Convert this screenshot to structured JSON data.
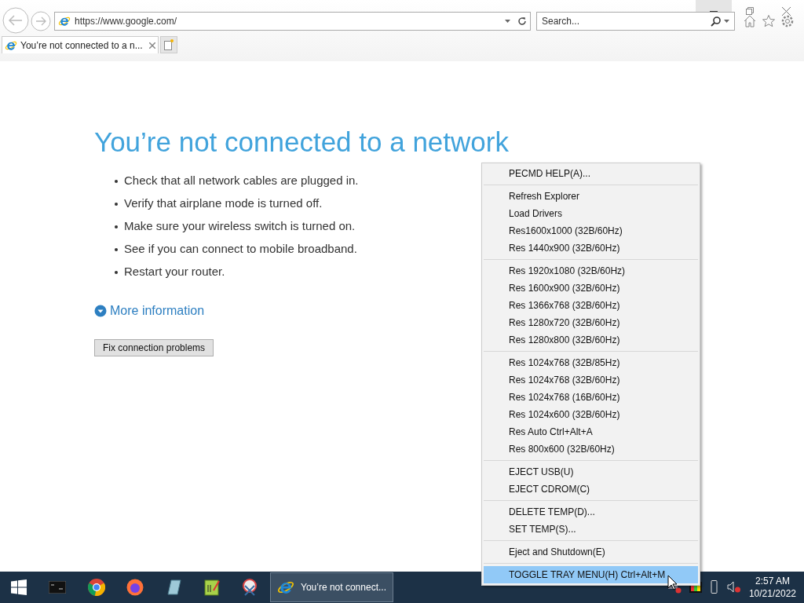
{
  "browser": {
    "address": "https://www.google.com/",
    "search_placeholder": "Search...",
    "tabs": [
      {
        "label": "You’re not connected to a n...",
        "selected": true
      }
    ]
  },
  "page": {
    "heading": "You’re not connected to a network",
    "bullets": [
      "Check that all network cables are plugged in.",
      "Verify that airplane mode is turned off.",
      "Make sure your wireless switch is turned on.",
      "See if you can connect to mobile broadband.",
      "Restart your router."
    ],
    "more_info": "More information",
    "fix_button": "Fix connection problems"
  },
  "context_menu": {
    "groups": [
      {
        "items": [
          {
            "label": "PECMD HELP(A)...",
            "selected": false
          }
        ]
      },
      {
        "items": [
          {
            "label": "Refresh Explorer",
            "selected": false
          },
          {
            "label": "Load Drivers",
            "selected": false
          },
          {
            "label": "Res1600x1000 (32B/60Hz)",
            "selected": false
          },
          {
            "label": "Res 1440x900 (32B/60Hz)",
            "selected": false
          }
        ]
      },
      {
        "items": [
          {
            "label": "Res 1920x1080 (32B/60Hz)",
            "selected": false
          },
          {
            "label": "Res 1600x900 (32B/60Hz)",
            "selected": false
          },
          {
            "label": "Res 1366x768 (32B/60Hz)",
            "selected": false
          },
          {
            "label": "Res 1280x720 (32B/60Hz)",
            "selected": false
          },
          {
            "label": "Res 1280x800 (32B/60Hz)",
            "selected": false
          }
        ]
      },
      {
        "items": [
          {
            "label": "Res 1024x768 (32B/85Hz)",
            "selected": false
          },
          {
            "label": "Res 1024x768 (32B/60Hz)",
            "selected": false
          },
          {
            "label": "Res 1024x768 (16B/60Hz)",
            "selected": false
          },
          {
            "label": "Res 1024x600 (32B/60Hz)",
            "selected": false
          },
          {
            "label": "Res Auto Ctrl+Alt+A",
            "selected": false
          },
          {
            "label": "Res 800x600 (32B/60Hz)",
            "selected": false
          }
        ]
      },
      {
        "items": [
          {
            "label": "EJECT USB(U)",
            "selected": false
          },
          {
            "label": "EJECT CDROM(C)",
            "selected": false
          }
        ]
      },
      {
        "items": [
          {
            "label": "DELETE TEMP(D)...",
            "selected": false
          },
          {
            "label": "SET TEMP(S)...",
            "selected": false
          }
        ]
      },
      {
        "items": [
          {
            "label": "Eject and Shutdown(E)",
            "selected": false
          }
        ]
      },
      {
        "items": [
          {
            "label": "TOGGLE TRAY MENU(H) Ctrl+Alt+M",
            "selected": true
          }
        ]
      }
    ]
  },
  "taskbar": {
    "windows": [
      {
        "label": "You’re not connect...",
        "selected": true
      }
    ],
    "time": "2:57 AM",
    "date": "10/21/2022"
  }
}
